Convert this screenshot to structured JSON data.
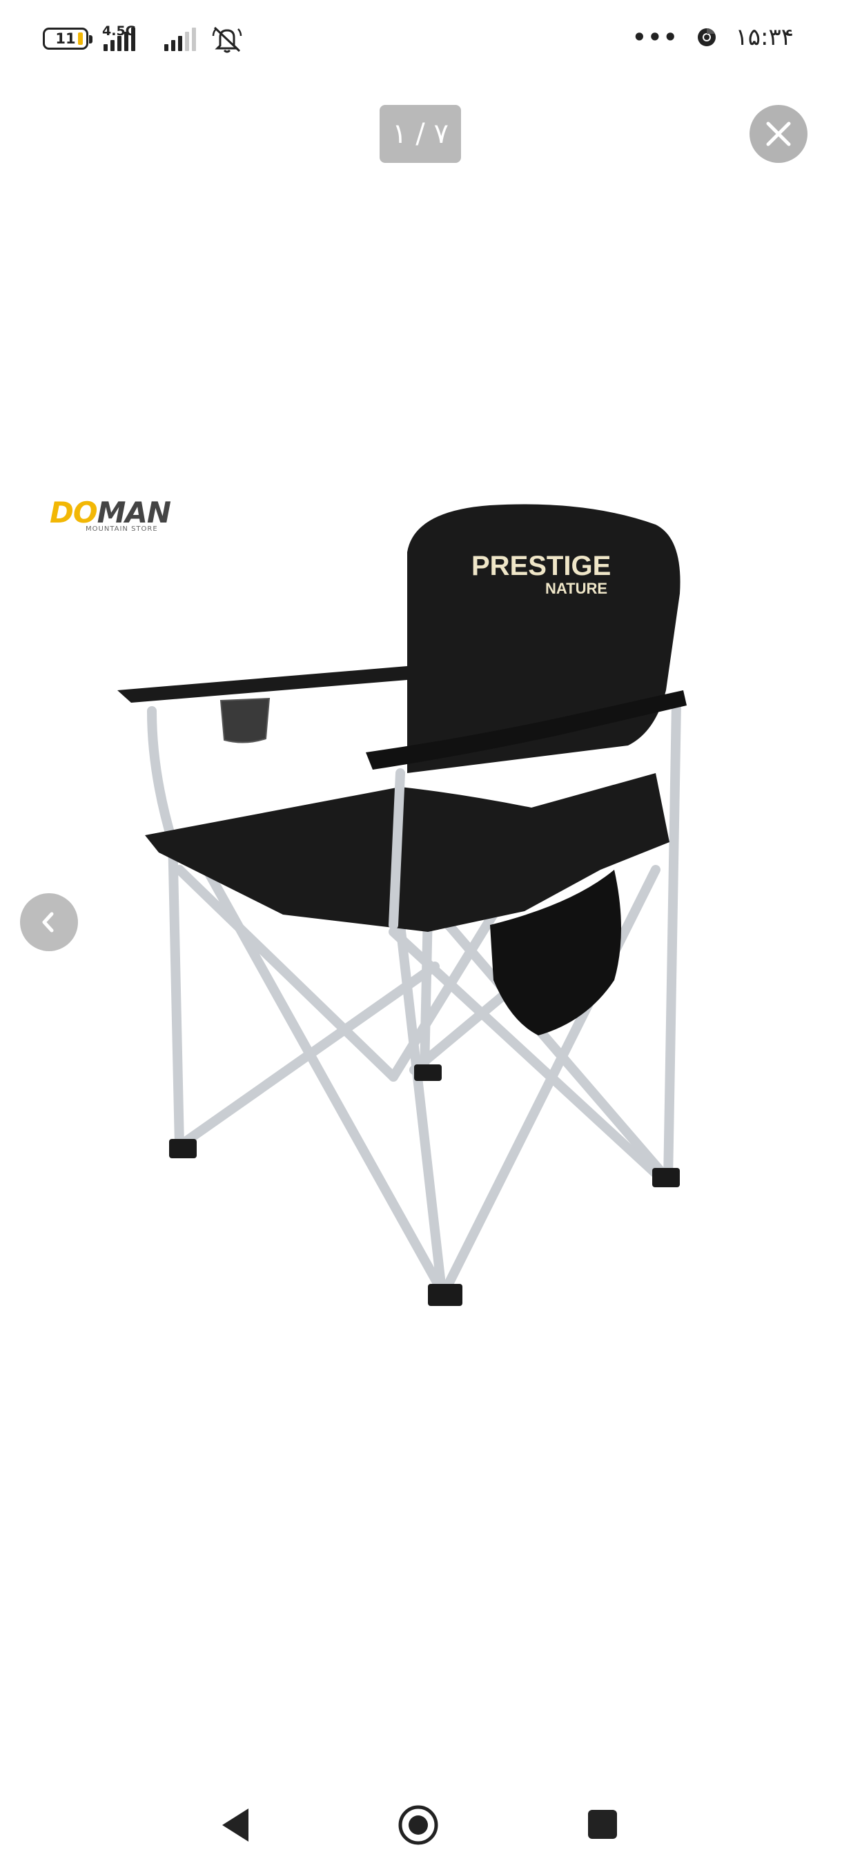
{
  "status_bar": {
    "battery_level": "11",
    "network_type": "4.5G",
    "overflow_indicator": "•••",
    "time": "۱۵:۳۴"
  },
  "viewer": {
    "counter_text": "۱ / ۷",
    "watermark": {
      "brand_first": "DO",
      "brand_rest": "MAN",
      "subtitle": "MOUNTAIN STORE"
    },
    "product_label": {
      "line1": "PRESTIGE",
      "line2": "NATURE"
    }
  },
  "icons": {
    "close": "close-icon",
    "previous": "chevron-left-icon",
    "nav_back": "back-triangle-icon",
    "nav_home": "home-circle-icon",
    "nav_recents": "recents-square-icon"
  },
  "colors": {
    "overlay_gray": "#b3b3b3",
    "watermark_accent": "#f2b705",
    "chair_fabric": "#1a1a1a",
    "chair_frame": "#c9cdd2"
  }
}
